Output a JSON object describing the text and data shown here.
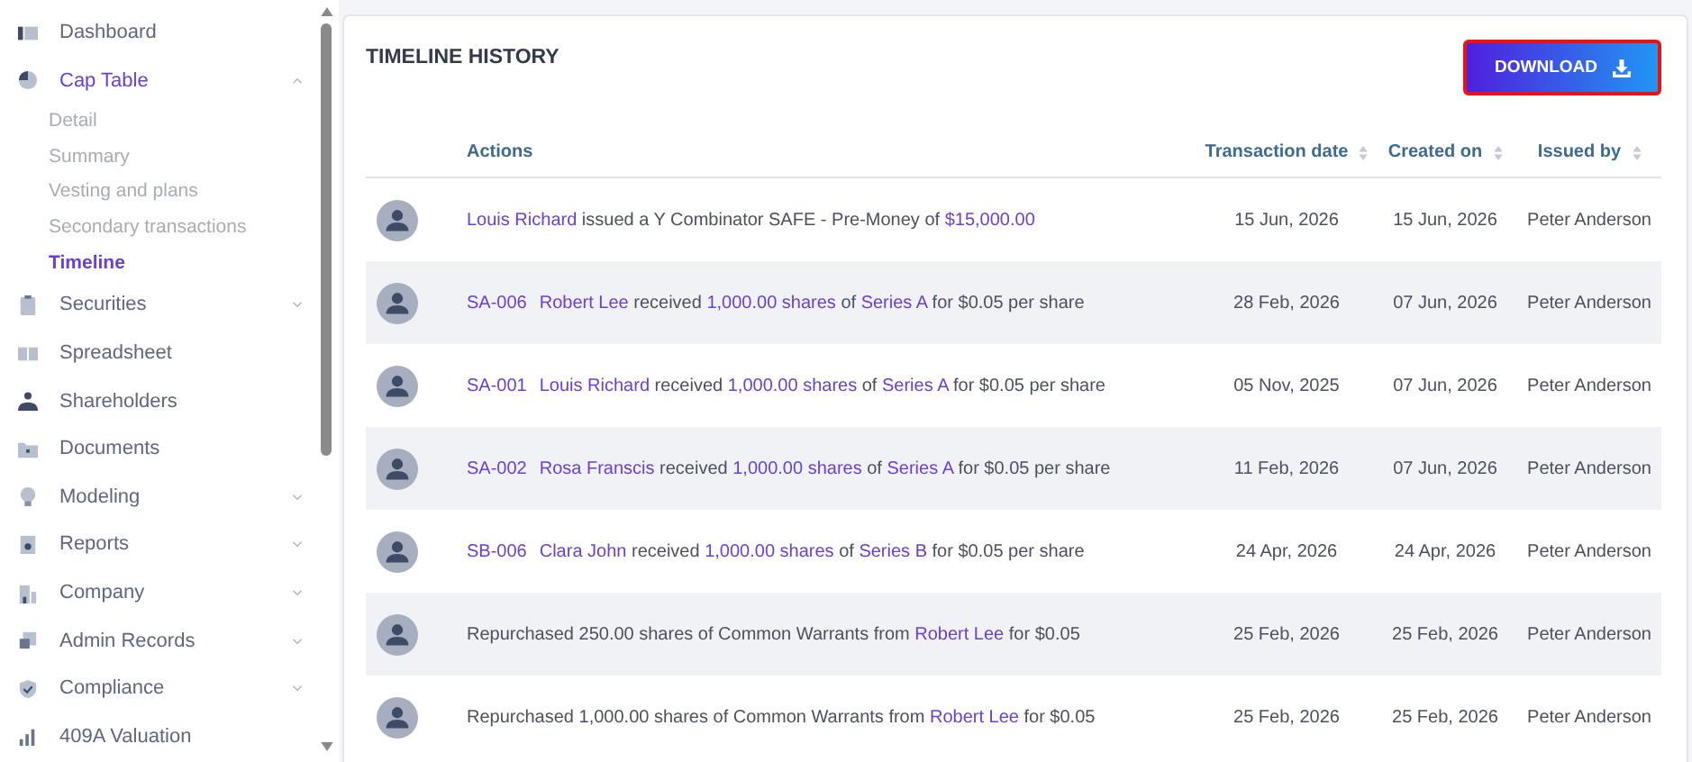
{
  "sidebar": {
    "items": [
      {
        "label": "Dashboard",
        "selected": false
      },
      {
        "label": "Cap Table",
        "selected": true,
        "expanded": true,
        "children": [
          {
            "label": "Detail",
            "selected": false
          },
          {
            "label": "Summary",
            "selected": false
          },
          {
            "label": "Vesting and plans",
            "selected": false
          },
          {
            "label": "Secondary transactions",
            "selected": false
          },
          {
            "label": "Timeline",
            "selected": true
          }
        ]
      },
      {
        "label": "Securities",
        "selected": false,
        "expanded": false
      },
      {
        "label": "Spreadsheet",
        "selected": false
      },
      {
        "label": "Shareholders",
        "selected": false
      },
      {
        "label": "Documents",
        "selected": false
      },
      {
        "label": "Modeling",
        "selected": false,
        "expanded": false
      },
      {
        "label": "Reports",
        "selected": false,
        "expanded": false
      },
      {
        "label": "Company",
        "selected": false,
        "expanded": false
      },
      {
        "label": "Admin Records",
        "selected": false,
        "expanded": false
      },
      {
        "label": "Compliance",
        "selected": false,
        "expanded": false
      },
      {
        "label": "409A Valuation",
        "selected": false
      }
    ]
  },
  "panel": {
    "title": "TIMELINE HISTORY",
    "download_button": "DOWNLOAD",
    "table": {
      "columns": [
        {
          "label": "Actions",
          "sortable": false
        },
        {
          "label": "Transaction date",
          "sortable": true
        },
        {
          "label": "Created on",
          "sortable": true
        },
        {
          "label": "Issued by",
          "sortable": true
        }
      ],
      "rows": [
        {
          "action": [
            {
              "kind": "link",
              "text": "Louis Richard"
            },
            {
              "kind": "text",
              "text": " issued a Y Combinator SAFE - Pre-Money of "
            },
            {
              "kind": "link",
              "text": "$15,000.00"
            }
          ],
          "transaction_date": "15 Jun, 2026",
          "created_on": "15 Jun, 2026",
          "issued_by": "Peter Anderson"
        },
        {
          "action": [
            {
              "kind": "code",
              "text": "SA-006"
            },
            {
              "kind": "link",
              "text": "Robert Lee"
            },
            {
              "kind": "text",
              "text": " received "
            },
            {
              "kind": "link",
              "text": "1,000.00 shares"
            },
            {
              "kind": "text",
              "text": " of "
            },
            {
              "kind": "link",
              "text": "Series A"
            },
            {
              "kind": "text",
              "text": " for $0.05 per share"
            }
          ],
          "transaction_date": "28 Feb, 2026",
          "created_on": "07 Jun, 2026",
          "issued_by": "Peter Anderson"
        },
        {
          "action": [
            {
              "kind": "code",
              "text": "SA-001"
            },
            {
              "kind": "link",
              "text": "Louis Richard"
            },
            {
              "kind": "text",
              "text": " received "
            },
            {
              "kind": "link",
              "text": "1,000.00 shares"
            },
            {
              "kind": "text",
              "text": " of "
            },
            {
              "kind": "link",
              "text": "Series A"
            },
            {
              "kind": "text",
              "text": " for $0.05 per share"
            }
          ],
          "transaction_date": "05 Nov, 2025",
          "created_on": "07 Jun, 2026",
          "issued_by": "Peter Anderson"
        },
        {
          "action": [
            {
              "kind": "code",
              "text": "SA-002"
            },
            {
              "kind": "link",
              "text": "Rosa Franscis"
            },
            {
              "kind": "text",
              "text": " received "
            },
            {
              "kind": "link",
              "text": "1,000.00 shares"
            },
            {
              "kind": "text",
              "text": " of "
            },
            {
              "kind": "link",
              "text": "Series A"
            },
            {
              "kind": "text",
              "text": " for $0.05 per share"
            }
          ],
          "transaction_date": "11 Feb, 2026",
          "created_on": "07 Jun, 2026",
          "issued_by": "Peter Anderson"
        },
        {
          "action": [
            {
              "kind": "code",
              "text": "SB-006"
            },
            {
              "kind": "link",
              "text": "Clara John"
            },
            {
              "kind": "text",
              "text": " received "
            },
            {
              "kind": "link",
              "text": "1,000.00 shares"
            },
            {
              "kind": "text",
              "text": " of "
            },
            {
              "kind": "link",
              "text": "Series B"
            },
            {
              "kind": "text",
              "text": " for $0.05 per share"
            }
          ],
          "transaction_date": "24 Apr, 2026",
          "created_on": "24 Apr, 2026",
          "issued_by": "Peter Anderson"
        },
        {
          "action": [
            {
              "kind": "text",
              "text": "Repurchased 250.00 shares of Common Warrants from "
            },
            {
              "kind": "link",
              "text": "Robert Lee"
            },
            {
              "kind": "text",
              "text": " for $0.05"
            }
          ],
          "transaction_date": "25 Feb, 2026",
          "created_on": "25 Feb, 2026",
          "issued_by": "Peter Anderson"
        },
        {
          "action": [
            {
              "kind": "text",
              "text": "Repurchased 1,000.00 shares of Common Warrants from "
            },
            {
              "kind": "link",
              "text": "Robert Lee"
            },
            {
              "kind": "text",
              "text": " for $0.05"
            }
          ],
          "transaction_date": "25 Feb, 2026",
          "created_on": "25 Feb, 2026",
          "issued_by": "Peter Anderson"
        }
      ]
    }
  }
}
